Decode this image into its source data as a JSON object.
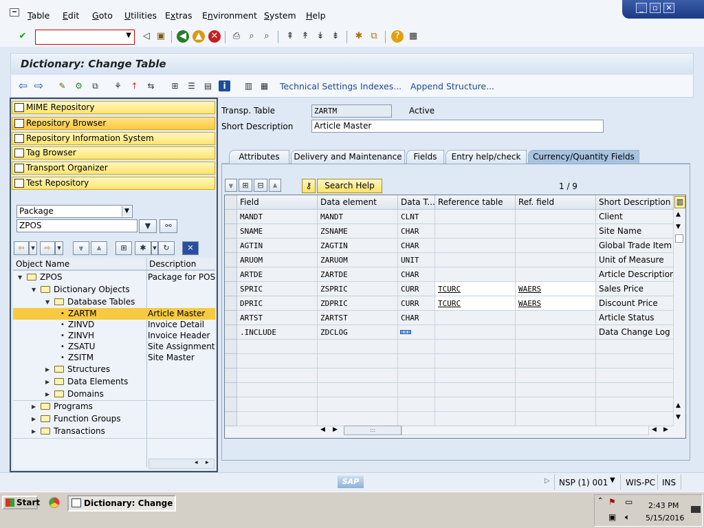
{
  "menus": [
    "Table",
    "Edit",
    "Goto",
    "Utilities",
    "Extras",
    "Environment",
    "System",
    "Help"
  ],
  "menu_mnemonics": [
    "T",
    "E",
    "G",
    "U",
    "x",
    "n",
    "S",
    "H"
  ],
  "window_controls": {
    "minimize": "_",
    "restore": "▫",
    "close": "✕"
  },
  "command_field": {
    "value": ""
  },
  "screen_title": "Dictionary: Change Table",
  "app_links": {
    "technical_settings": "Technical Settings",
    "indexes": "Indexes...",
    "append_structure": "Append Structure..."
  },
  "nav_buttons": [
    {
      "label": "MIME Repository",
      "icon": "mime-icon"
    },
    {
      "label": "Repository Browser",
      "icon": "repository-browser-icon"
    },
    {
      "label": "Repository Information System",
      "icon": "info-system-icon"
    },
    {
      "label": "Tag Browser",
      "icon": "tag-icon"
    },
    {
      "label": "Transport Organizer",
      "icon": "transport-icon"
    },
    {
      "label": "Test Repository",
      "icon": "test-icon"
    }
  ],
  "object_type_select": "Package",
  "object_name_input": "ZPOS",
  "tree": {
    "col_object": "Object Name",
    "col_desc": "Description",
    "rows": [
      {
        "label": "ZPOS",
        "desc": "Package for POS Data",
        "level": 0,
        "type": "folder",
        "open": true
      },
      {
        "label": "Dictionary Objects",
        "desc": "",
        "level": 1,
        "type": "folder",
        "open": true
      },
      {
        "label": "Database Tables",
        "desc": "",
        "level": 2,
        "type": "folder",
        "open": true
      },
      {
        "label": "ZARTM",
        "desc": "Article Master",
        "level": 3,
        "type": "leaf",
        "selected": true
      },
      {
        "label": "ZINVD",
        "desc": "Invoice Detail",
        "level": 3,
        "type": "leaf"
      },
      {
        "label": "ZINVH",
        "desc": "Invoice Header",
        "level": 3,
        "type": "leaf"
      },
      {
        "label": "ZSATU",
        "desc": "Site Assignment t",
        "level": 3,
        "type": "leaf"
      },
      {
        "label": "ZSITM",
        "desc": "Site Master",
        "level": 3,
        "type": "leaf"
      },
      {
        "label": "Structures",
        "desc": "",
        "level": 2,
        "type": "folder",
        "open": false
      },
      {
        "label": "Data Elements",
        "desc": "",
        "level": 2,
        "type": "folder",
        "open": false
      },
      {
        "label": "Domains",
        "desc": "",
        "level": 2,
        "type": "folder",
        "open": false
      },
      {
        "label": "Programs",
        "desc": "",
        "level": 1,
        "type": "folder",
        "open": false
      },
      {
        "label": "Function Groups",
        "desc": "",
        "level": 1,
        "type": "folder",
        "open": false
      },
      {
        "label": "Transactions",
        "desc": "",
        "level": 1,
        "type": "folder",
        "open": false
      }
    ]
  },
  "header_fields": {
    "transp_table_label": "Transp. Table",
    "transp_table_value": "ZARTM",
    "status": "Active",
    "short_desc_label": "Short Description",
    "short_desc_value": "Article Master"
  },
  "tabs": [
    "Attributes",
    "Delivery and Maintenance",
    "Fields",
    "Entry help/check",
    "Currency/Quantity Fields"
  ],
  "active_tab": 4,
  "search_help_label": "Search Help",
  "pager": "1 / 9",
  "grid": {
    "columns": [
      "Field",
      "Data element",
      "Data T...",
      "Reference table",
      "Ref. field",
      "Short Description"
    ],
    "rows": [
      {
        "field": "MANDT",
        "element": "MANDT",
        "type": "CLNT",
        "ref_table": "",
        "ref_field": "",
        "desc": "Client"
      },
      {
        "field": "SNAME",
        "element": "ZSNAME",
        "type": "CHAR",
        "ref_table": "",
        "ref_field": "",
        "desc": "Site Name"
      },
      {
        "field": "AGTIN",
        "element": "ZAGTIN",
        "type": "CHAR",
        "ref_table": "",
        "ref_field": "",
        "desc": "Global Trade Item N"
      },
      {
        "field": "ARUOM",
        "element": "ZARUOM",
        "type": "UNIT",
        "ref_table": "",
        "ref_field": "",
        "desc": "Unit of Measure"
      },
      {
        "field": "ARTDE",
        "element": "ZARTDE",
        "type": "CHAR",
        "ref_table": "",
        "ref_field": "",
        "desc": "Article Description"
      },
      {
        "field": "SPRIC",
        "element": "ZSPRIC",
        "type": "CURR",
        "ref_table": "TCURC",
        "ref_field": "WAERS",
        "desc": "Sales Price"
      },
      {
        "field": "DPRIC",
        "element": "ZDPRIC",
        "type": "CURR",
        "ref_table": "TCURC",
        "ref_field": "WAERS",
        "desc": "Discount Price"
      },
      {
        "field": "ARTST",
        "element": "ZARTST",
        "type": "CHAR",
        "ref_table": "",
        "ref_field": "",
        "desc": "Article Status"
      },
      {
        "field": ".INCLUDE",
        "element": "ZDCLOG",
        "type": "",
        "ref_table": "",
        "ref_field": "",
        "desc": "Data Change Log"
      }
    ],
    "empty_rows": 6
  },
  "statusbar": {
    "sap_logo": "SAP",
    "system": "NSP (1) 001",
    "host": "WIS-PC",
    "mode": "INS"
  },
  "taskbar": {
    "start": "Start",
    "active_window": "Dictionary: Change Ta...",
    "time": "2:43 PM",
    "date": "5/15/2016"
  }
}
